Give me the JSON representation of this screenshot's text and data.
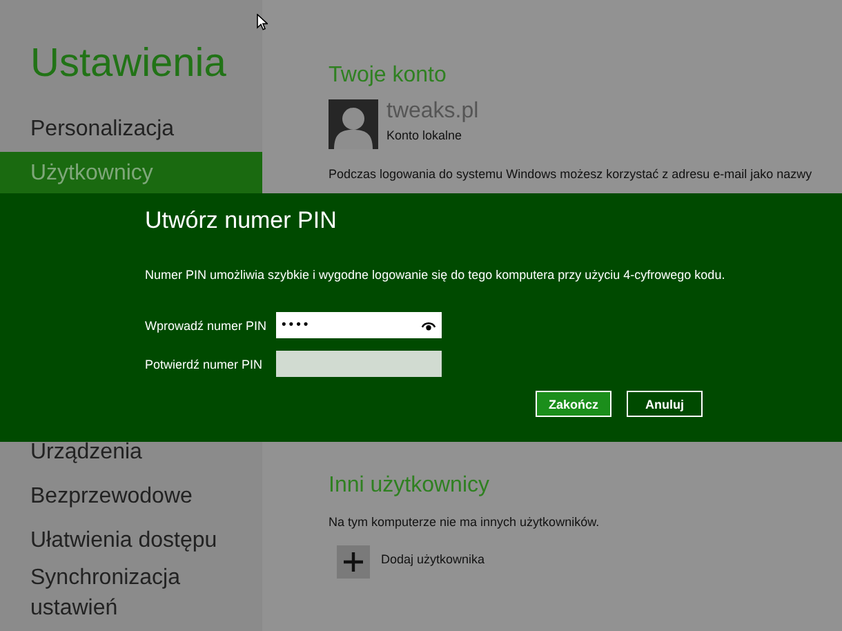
{
  "sidebar": {
    "title": "Ustawienia",
    "items": [
      {
        "label": "Personalizacja",
        "selected": false
      },
      {
        "label": "Użytkownicy",
        "selected": true
      }
    ],
    "more_items": [
      {
        "label": "Urządzenia",
        "selected": false
      },
      {
        "label": "Bezprzewodowe",
        "selected": false
      },
      {
        "label": "Ułatwienia dostępu",
        "selected": false
      },
      {
        "label": "Synchronizacja ustawień",
        "selected": false
      }
    ]
  },
  "account": {
    "heading": "Twoje konto",
    "name": "tweaks.pl",
    "type": "Konto lokalne",
    "text": "Podczas logowania do systemu Windows możesz korzystać z adresu e-mail jako nazwy"
  },
  "others": {
    "heading": "Inni użytkownicy",
    "text": "Na tym komputerze nie ma innych użytkowników.",
    "add_label": "Dodaj użytkownika"
  },
  "dialog": {
    "title": "Utwórz numer PIN",
    "description": "Numer PIN umożliwia szybkie i wygodne logowanie się do tego komputera przy użyciu 4-cyfrowego kodu.",
    "fields": [
      {
        "label": "Wprowadź numer PIN",
        "value": "••••",
        "disabled": false,
        "reveal": true
      },
      {
        "label": "Potwierdź numer PIN",
        "disabled": true,
        "reveal": false
      }
    ],
    "buttons": [
      {
        "label": "Zakończ",
        "kind": "primary"
      },
      {
        "label": "Anuluj",
        "kind": "secondary"
      }
    ]
  }
}
